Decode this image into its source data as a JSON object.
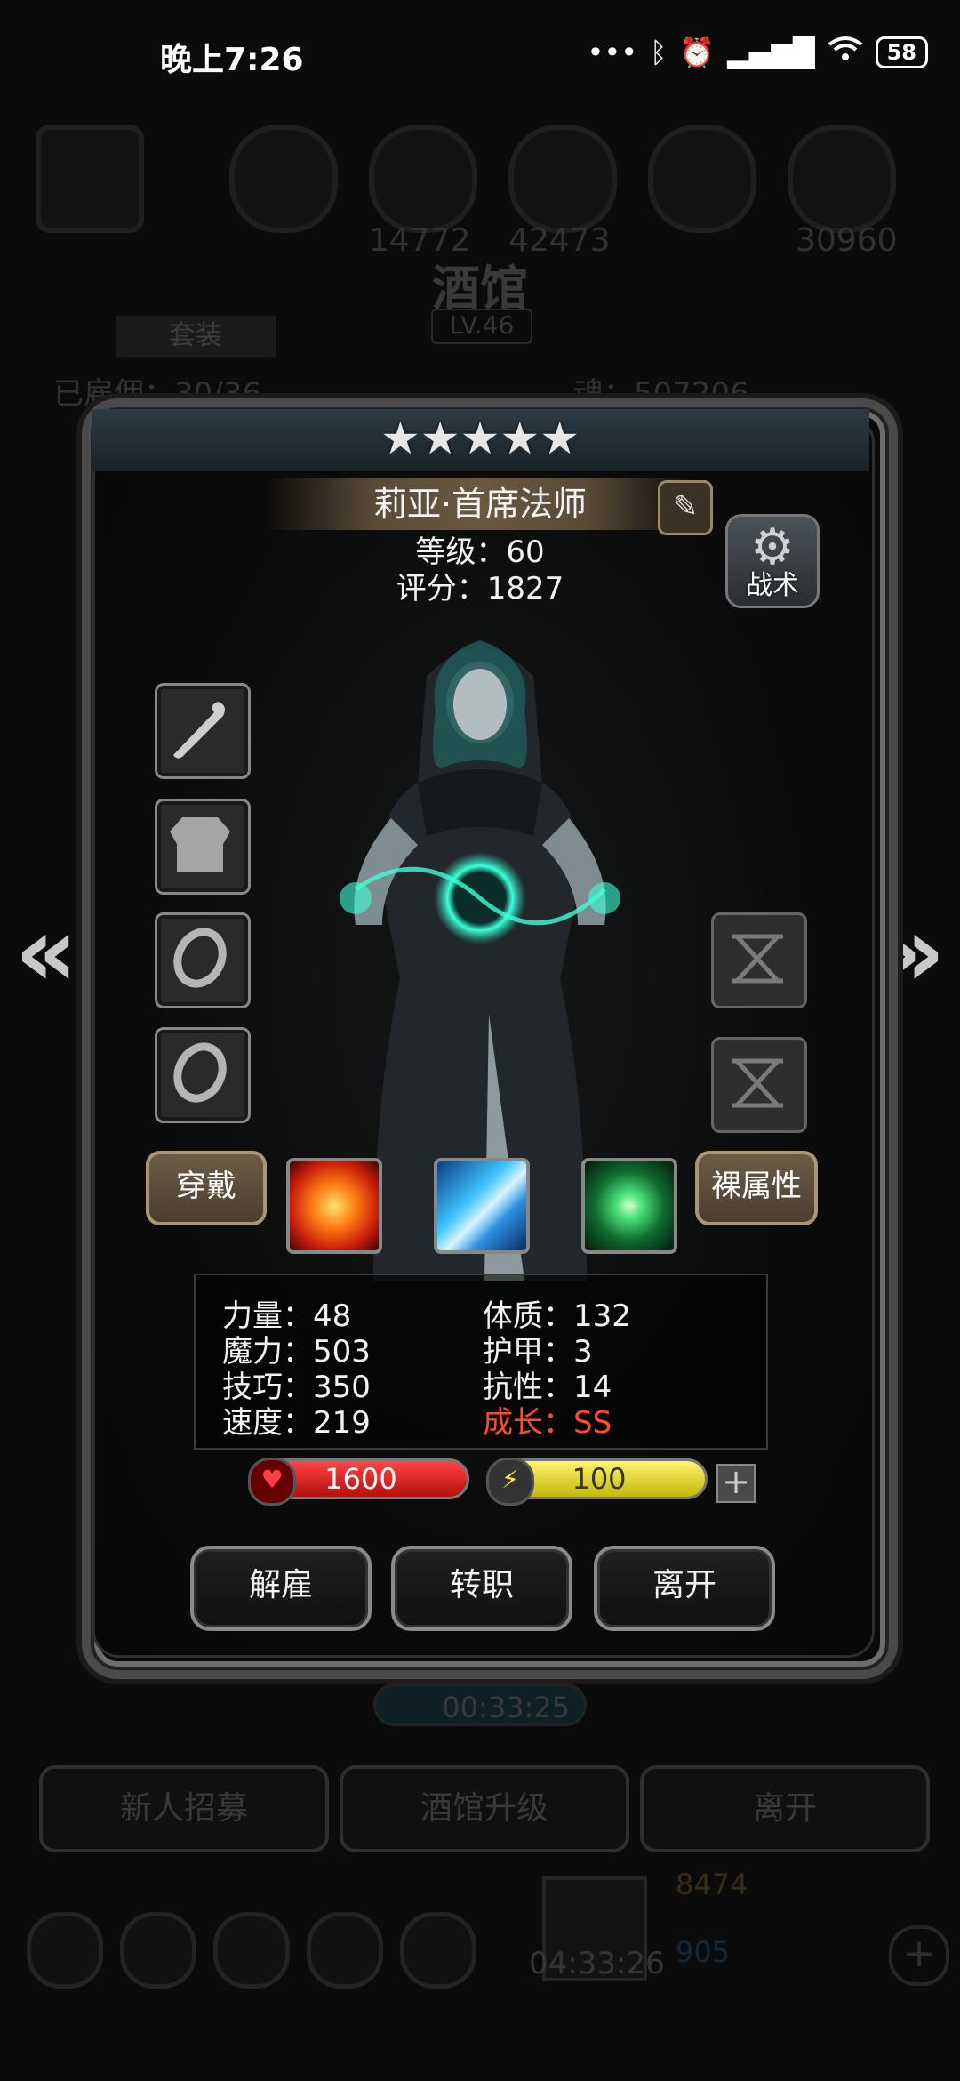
{
  "status_bar": {
    "time": "晚上7:26",
    "icons": [
      "more-icon",
      "bluetooth-icon",
      "alarm-icon",
      "signal-icon",
      "wifi-icon"
    ],
    "battery": "58"
  },
  "background": {
    "title": "酒馆",
    "level": "LV.46",
    "set_button": "套装",
    "count_text": "已雇佣：30/36",
    "soul_text": "魂：507206",
    "resource_values": [
      "14772",
      "42473",
      "30960"
    ],
    "timer": "00:33:25",
    "bottom_buttons": [
      "新人招募",
      "酒馆升级",
      "离开"
    ],
    "gold": "8474",
    "gems": "905",
    "gift_timer": "04:33:26"
  },
  "hero": {
    "stars": "★★★★★",
    "name": "莉亚·首席法师",
    "level_text": "等级：60",
    "score_text": "评分：1827",
    "tactics_label": "战术",
    "wear_label": "穿戴",
    "naked_label": "裸属性",
    "stats": {
      "strength": "力量：48",
      "magic": "魔力：503",
      "skill": "技巧：350",
      "speed": "速度：219",
      "constitution": "体质：132",
      "armor": "护甲：3",
      "resistance": "抗性：14",
      "growth": "成长：SS"
    },
    "hp": "1600",
    "energy": "100",
    "colors": {
      "growth": "#ff4b2b",
      "hp": "#d41a1a",
      "energy": "#e8dc28"
    }
  },
  "actions": {
    "dismiss": "解雇",
    "change_class": "转职",
    "leave": "离开"
  },
  "nav": {
    "prev": "«",
    "next": "»"
  }
}
